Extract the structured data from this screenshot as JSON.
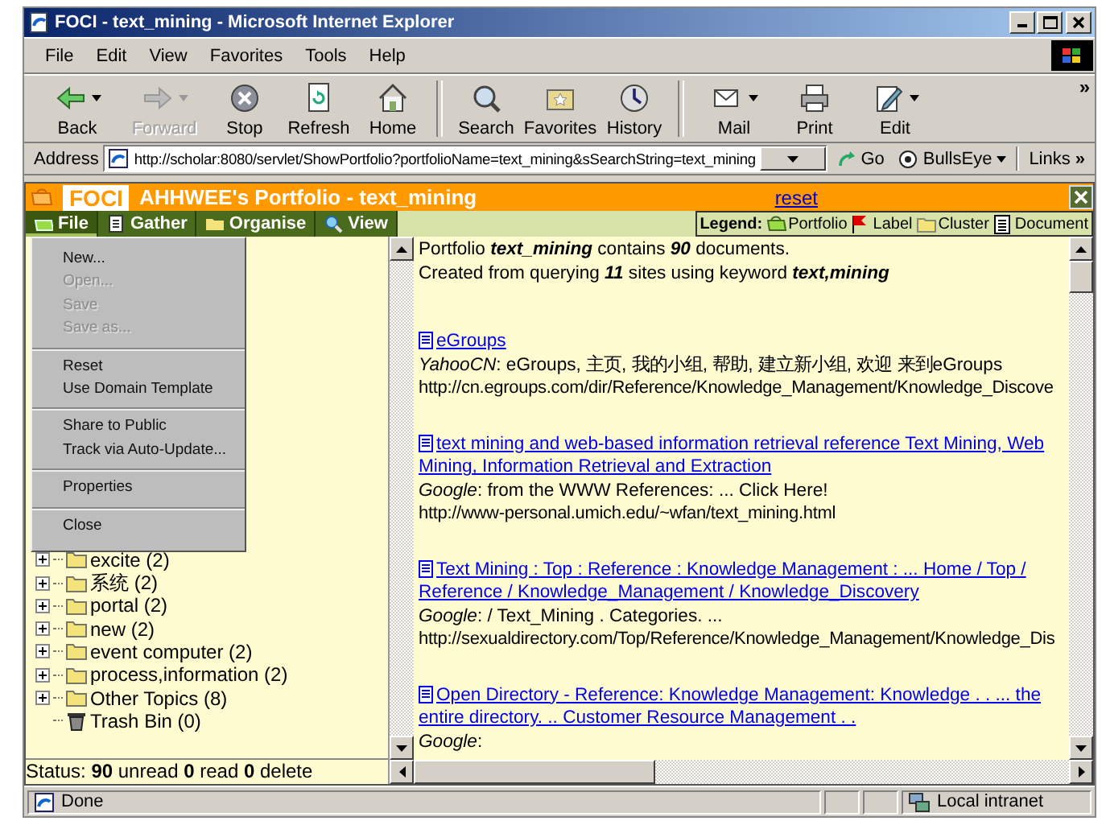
{
  "window": {
    "title": "FOCI - text_mining - Microsoft Internet Explorer"
  },
  "menu_bar": [
    "File",
    "Edit",
    "View",
    "Favorites",
    "Tools",
    "Help"
  ],
  "toolbar": [
    {
      "label": "Back",
      "disabled": false
    },
    {
      "label": "Forward",
      "disabled": true
    },
    {
      "label": "Stop",
      "disabled": false
    },
    {
      "label": "Refresh",
      "disabled": false
    },
    {
      "label": "Home",
      "disabled": false
    },
    {
      "label": "Search",
      "disabled": false
    },
    {
      "label": "Favorites",
      "disabled": false
    },
    {
      "label": "History",
      "disabled": false
    },
    {
      "label": "Mail",
      "disabled": false
    },
    {
      "label": "Print",
      "disabled": false
    },
    {
      "label": "Edit",
      "disabled": false
    }
  ],
  "toolbar_more": "»",
  "address_bar": {
    "label": "Address",
    "value": "http://scholar:8080/servlet/ShowPortfolio?portfolioName=text_mining&sSearchString=text_mining",
    "go": "Go",
    "bullseye": "BullsEye",
    "links": "Links",
    "links_more": "»"
  },
  "app": {
    "logo": "FOCI",
    "title": "AHHWEE's Portfolio - text_mining",
    "reset": "reset"
  },
  "tabs": [
    {
      "label": "File",
      "selected": true
    },
    {
      "label": "Gather",
      "selected": false
    },
    {
      "label": "Organise",
      "selected": false
    },
    {
      "label": "View",
      "selected": false
    }
  ],
  "legend": {
    "title": "Legend:",
    "items": [
      "Portfolio",
      "Label",
      "Cluster",
      "Document"
    ]
  },
  "file_menu": [
    [
      {
        "label": "New...",
        "disabled": false
      },
      {
        "label": "Open...",
        "disabled": true
      },
      {
        "label": "Save",
        "disabled": true
      },
      {
        "label": "Save as...",
        "disabled": true
      }
    ],
    [
      {
        "label": "Reset",
        "disabled": false
      },
      {
        "label": "Use Domain Template",
        "disabled": false
      }
    ],
    [
      {
        "label": "Share to Public",
        "disabled": false
      },
      {
        "label": "Track via Auto-Update...",
        "disabled": false
      }
    ],
    [
      {
        "label": "Properties",
        "disabled": false
      }
    ],
    [
      {
        "label": "Close",
        "disabled": false
      }
    ]
  ],
  "tree": [
    {
      "kind": "folder",
      "label": "excite (2)",
      "expanded": false
    },
    {
      "kind": "folder",
      "label": "系统 (2)",
      "expanded": false
    },
    {
      "kind": "folder",
      "label": "portal (2)",
      "expanded": false
    },
    {
      "kind": "folder",
      "label": "new (2)",
      "expanded": false
    },
    {
      "kind": "folder",
      "label": "event computer (2)",
      "expanded": false
    },
    {
      "kind": "folder",
      "label": "process,information (2)",
      "expanded": false
    },
    {
      "kind": "folder",
      "label": "Other Topics (8)",
      "expanded": false
    },
    {
      "kind": "trash",
      "label": "Trash Bin (0)"
    }
  ],
  "status": "Status: **90** unread **0** read **0** delete",
  "summary": [
    "Portfolio **text_mining** contains **90** documents.",
    "Created from querying **11** sites using keyword **text,mining**"
  ],
  "results": [
    {
      "title": "eGroups",
      "description": "*YahooCN*: eGroups, 主页, 我的小组, 帮助, 建立新小组, 欢迎  来到eGroups",
      "url": "http://cn.egroups.com/dir/Reference/Knowledge_Management/Knowledge_Discove"
    },
    {
      "title": "text mining and web-based information retrieval reference Text Mining, Web Mining, Information Retrieval and Extraction",
      "description": "*Google*: from the WWW References: ... Click Here!",
      "url": "http://www-personal.umich.edu/~wfan/text_mining.html"
    },
    {
      "title": "Text Mining : Top : Reference : Knowledge Management : ... Home / Top / Reference / Knowledge_Management / Knowledge_Discovery",
      "description": "*Google*: / Text_Mining . Categories. ...",
      "url": "http://sexualdirectory.com/Top/Reference/Knowledge_Management/Knowledge_Dis"
    },
    {
      "title": "Open Directory - Reference: Knowledge Management: Knowledge . . ... the entire directory. .. Customer Resource Management . .",
      "description": "*Google*:"
    }
  ],
  "ie_status": {
    "text": "Done",
    "zone": "Local intranet"
  }
}
